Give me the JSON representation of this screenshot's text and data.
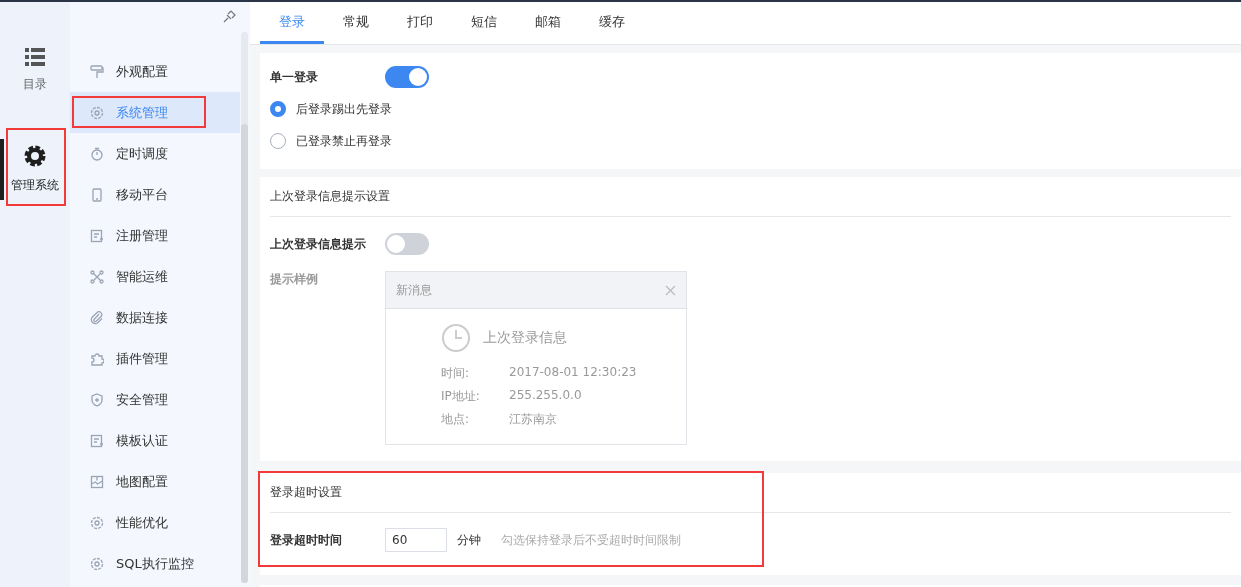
{
  "rail": [
    {
      "label": "目录",
      "selected": false,
      "highlighted": false
    },
    {
      "label": "管理系统",
      "selected": true,
      "highlighted": true
    }
  ],
  "sidebar": {
    "items": [
      {
        "label": "外观配置",
        "selected": false,
        "highlighted": false
      },
      {
        "label": "系统管理",
        "selected": true,
        "highlighted": true
      },
      {
        "label": "定时调度",
        "selected": false,
        "highlighted": false
      },
      {
        "label": "移动平台",
        "selected": false,
        "highlighted": false
      },
      {
        "label": "注册管理",
        "selected": false,
        "highlighted": false
      },
      {
        "label": "智能运维",
        "selected": false,
        "highlighted": false
      },
      {
        "label": "数据连接",
        "selected": false,
        "highlighted": false
      },
      {
        "label": "插件管理",
        "selected": false,
        "highlighted": false
      },
      {
        "label": "安全管理",
        "selected": false,
        "highlighted": false
      },
      {
        "label": "模板认证",
        "selected": false,
        "highlighted": false
      },
      {
        "label": "地图配置",
        "selected": false,
        "highlighted": false
      },
      {
        "label": "性能优化",
        "selected": false,
        "highlighted": false
      },
      {
        "label": "SQL执行监控",
        "selected": false,
        "highlighted": false
      }
    ]
  },
  "tabs": [
    {
      "label": "登录",
      "selected": true
    },
    {
      "label": "常规",
      "selected": false
    },
    {
      "label": "打印",
      "selected": false
    },
    {
      "label": "短信",
      "selected": false
    },
    {
      "label": "邮箱",
      "selected": false
    },
    {
      "label": "缓存",
      "selected": false
    }
  ],
  "single_login": {
    "label": "单一登录",
    "on": true,
    "options": [
      {
        "label": "后登录踢出先登录",
        "selected": true
      },
      {
        "label": "已登录禁止再登录",
        "selected": false
      }
    ]
  },
  "last_login": {
    "title": "上次登录信息提示设置",
    "toggle_label": "上次登录信息提示",
    "on": false,
    "sample_label": "提示样例",
    "sample": {
      "header": "新消息",
      "heading": "上次登录信息",
      "rows": [
        {
          "label": "时间:",
          "value": "2017-08-01 12:30:23"
        },
        {
          "label": "IP地址:",
          "value": "255.255.0.0"
        },
        {
          "label": "地点:",
          "value": "江苏南京"
        }
      ]
    }
  },
  "timeout": {
    "title": "登录超时设置",
    "highlighted": true,
    "label": "登录超时时间",
    "value": "60",
    "unit": "分钟",
    "hint": "勾选保持登录后不受超时时间限制"
  }
}
